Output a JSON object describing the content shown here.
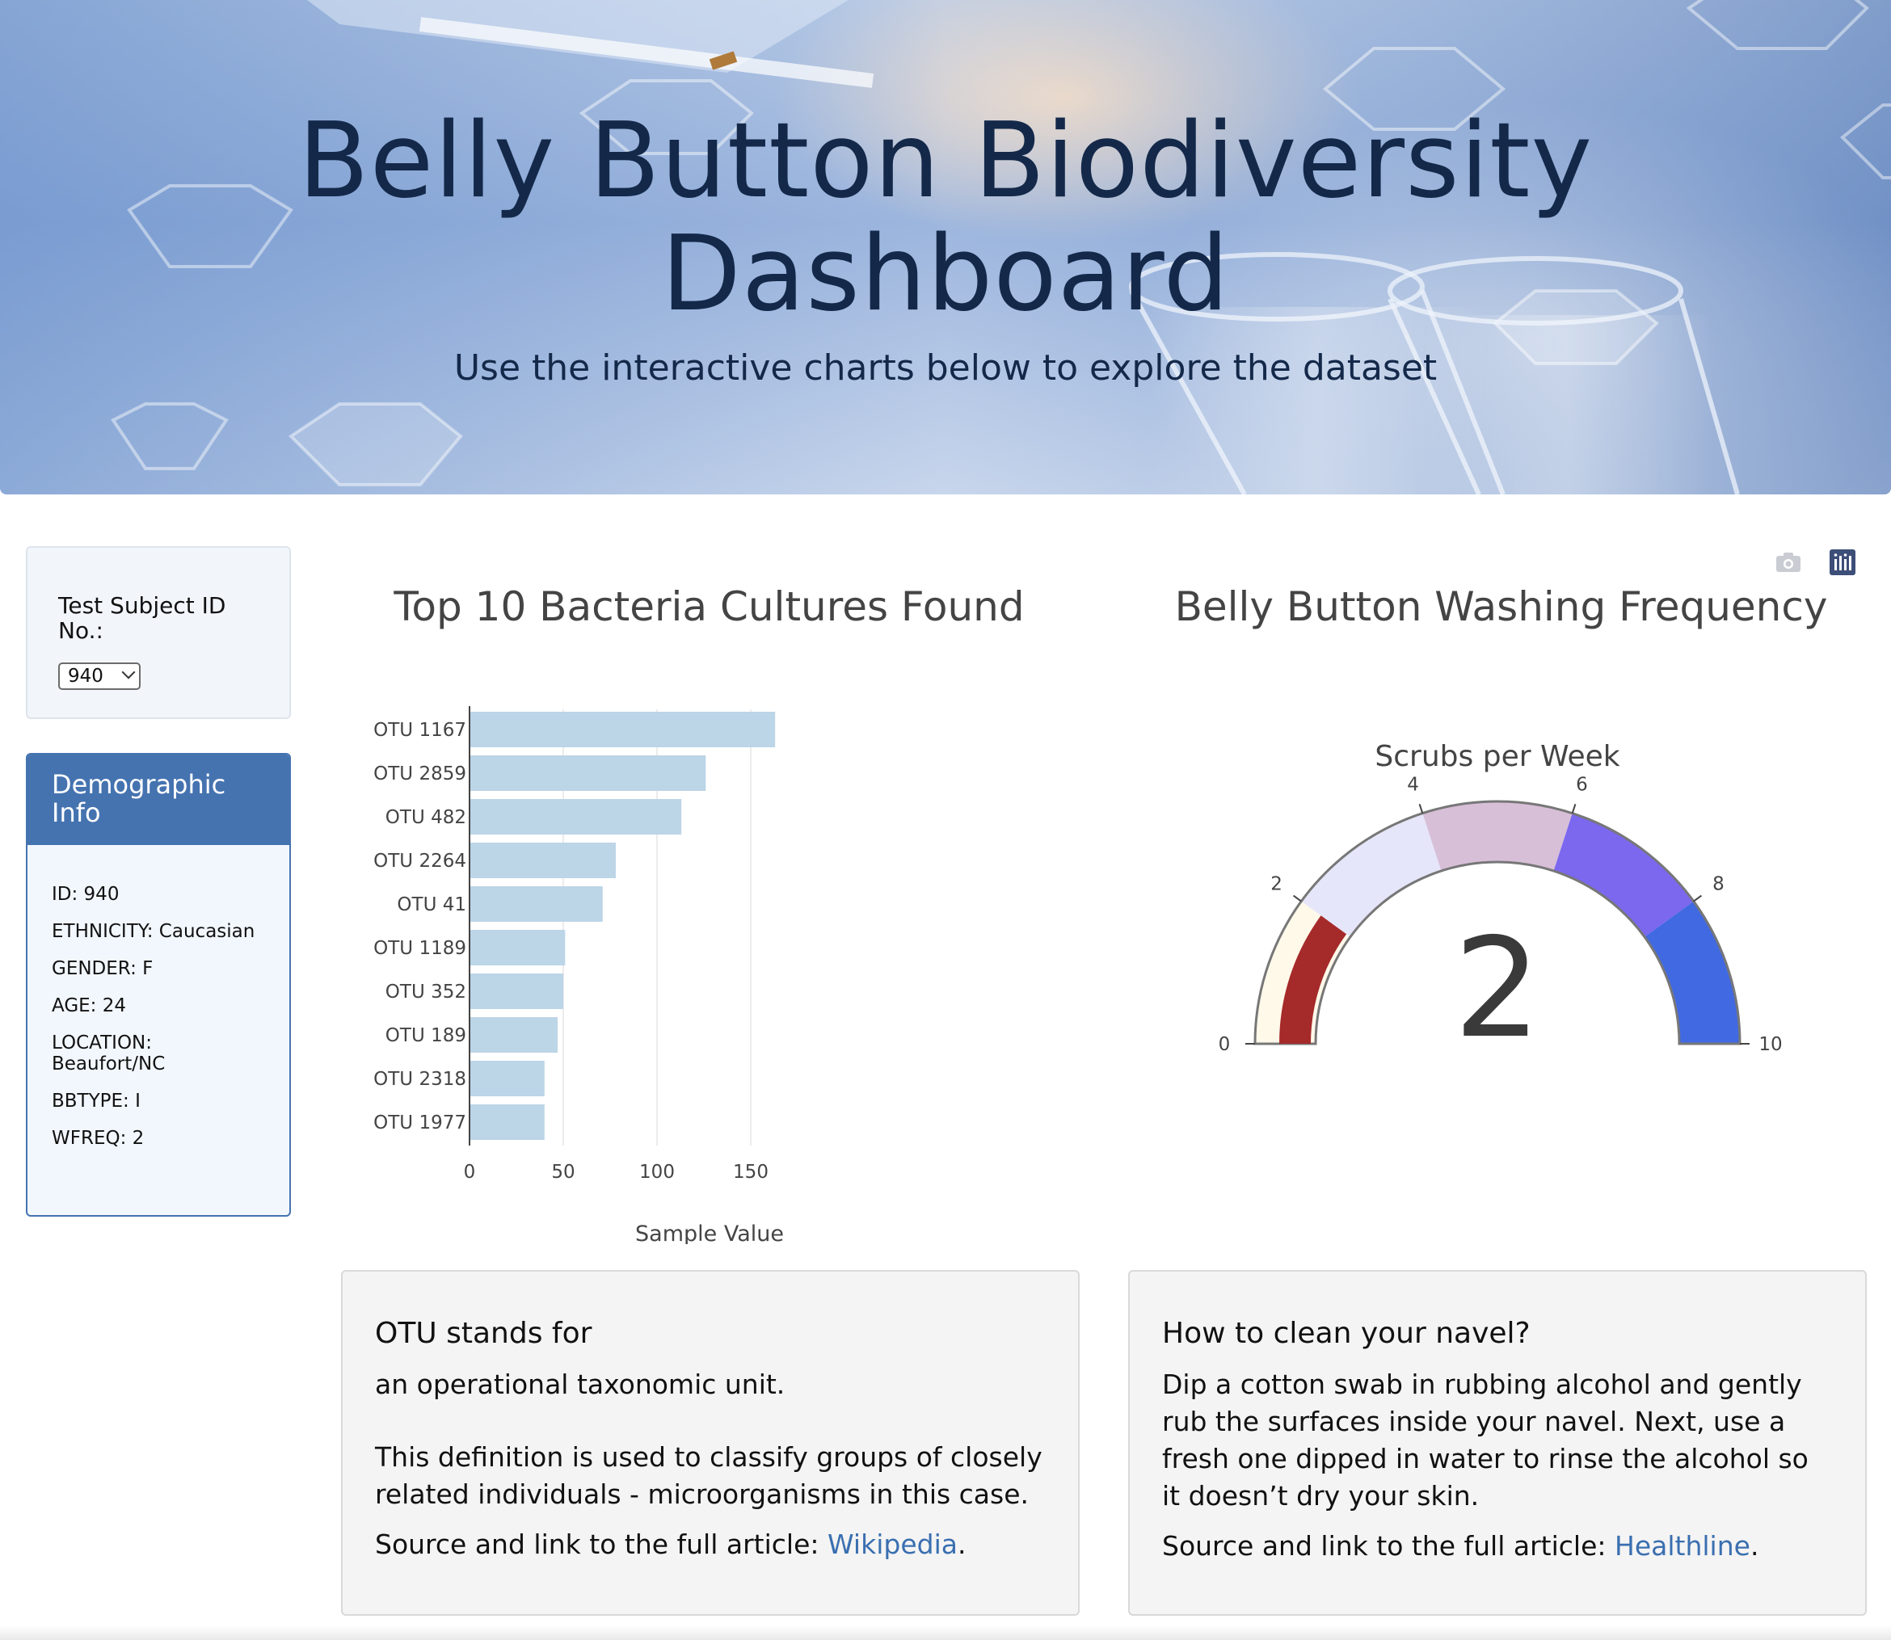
{
  "header": {
    "title_line1": "Belly Button Biodiversity",
    "title_line2": "Dashboard",
    "subtitle": "Use the interactive charts below to explore the dataset"
  },
  "selector": {
    "label": "Test Subject ID No.:",
    "selected": "940"
  },
  "demographics": {
    "title": "Demographic Info",
    "items": [
      "ID: 940",
      "ETHNICITY: Caucasian",
      "GENDER: F",
      "AGE: 24",
      "LOCATION: Beaufort/NC",
      "BBTYPE: I",
      "WFREQ: 2"
    ]
  },
  "modebar": {
    "icons": [
      "camera-icon",
      "plotly-logo-icon"
    ]
  },
  "chart_data": [
    {
      "type": "bar",
      "orientation": "horizontal",
      "title": "Top 10 Bacteria Cultures Found",
      "xlabel": "Sample Value",
      "ylabel": "",
      "categories": [
        "OTU 1167",
        "OTU 2859",
        "OTU 482",
        "OTU 2264",
        "OTU 41",
        "OTU 1189",
        "OTU 352",
        "OTU 189",
        "OTU 2318",
        "OTU 1977"
      ],
      "values": [
        163,
        126,
        113,
        78,
        71,
        51,
        50,
        47,
        40,
        40
      ],
      "xlim": [
        0,
        175
      ],
      "xticks": [
        "0",
        "50",
        "100",
        "150"
      ],
      "grid": "vertical",
      "bar_color": "#bcd5e7"
    },
    {
      "type": "gauge",
      "title": "Belly Button Washing Frequency",
      "subtitle": "Scrubs per Week",
      "value": 2,
      "range": [
        0,
        10
      ],
      "ticks": [
        "0",
        "2",
        "4",
        "6",
        "8",
        "10"
      ],
      "steps": [
        {
          "range": [
            0,
            2
          ],
          "color": "#fff9ea"
        },
        {
          "range": [
            2,
            4
          ],
          "color": "#e6e6fa"
        },
        {
          "range": [
            4,
            6
          ],
          "color": "#d8bfd8"
        },
        {
          "range": [
            6,
            8
          ],
          "color": "#7b68ee"
        },
        {
          "range": [
            8,
            10
          ],
          "color": "#4169e1"
        }
      ],
      "bar_color": "#a52a2a"
    }
  ],
  "cards": {
    "otu": {
      "title": "OTU stands for",
      "p1": "an operational taxonomic unit.",
      "p2": "This definition is used to classify groups of closely related individuals - microorganisms in this case.",
      "source_prefix": "Source and link to the full article: ",
      "link": "Wikipedia",
      "suffix": "."
    },
    "navel": {
      "title": "How to clean your navel?",
      "p1": "Dip a cotton swab in rubbing alcohol and gently rub the surfaces inside your navel. Next, use a fresh one dipped in water to rinse the alcohol so it doesn’t dry your skin.",
      "source_prefix": "Source and link to the full article: ",
      "link": "Healthline",
      "suffix": "."
    }
  }
}
